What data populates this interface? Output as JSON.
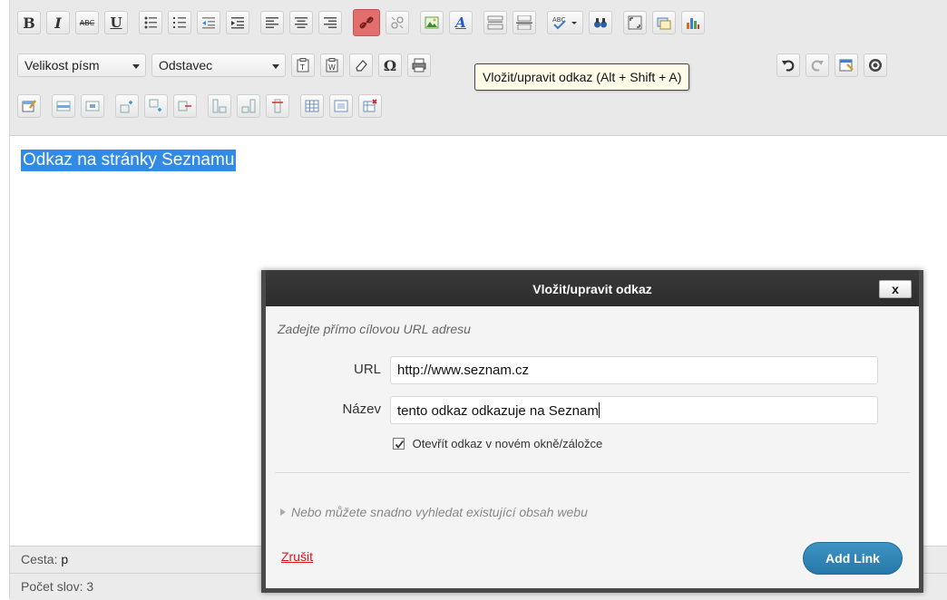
{
  "toolbar": {
    "font_size_label": "Velikost písm",
    "format_label": "Odstavec",
    "tooltip": "Vložit/upravit odkaz (Alt + Shift + A)"
  },
  "content": {
    "selected_text": "Odkaz na stránky Seznamu"
  },
  "status": {
    "path_label": "Cesta:",
    "path_value": "p",
    "word_count": "Počet slov: 3"
  },
  "dialog": {
    "title": "Vložit/upravit odkaz",
    "close_label": "x",
    "hint": "Zadejte přímo cílovou URL adresu",
    "url_label": "URL",
    "url_value": "http://www.seznam.cz",
    "name_label": "Název",
    "name_value": "tento odkaz odkazuje na Seznam",
    "new_window_label": "Otevřít odkaz v novém okně/záložce",
    "new_window_checked": true,
    "search_toggle": "Nebo můžete snadno vyhledat existující obsah webu",
    "cancel_label": "Zrušit",
    "submit_label": "Add Link"
  },
  "colors": {
    "accent_button": "#2678a8",
    "active_tool": "#e36e6e",
    "selection": "#2f8be6",
    "cancel_link": "#d9161c"
  },
  "icons": [
    "bold",
    "italic",
    "strikethrough",
    "underline",
    "bullet-list",
    "numbered-list",
    "outdent",
    "indent",
    "align-left",
    "align-center",
    "align-right",
    "link",
    "unlink",
    "image",
    "text-color",
    "more-tag",
    "page-break",
    "spellcheck",
    "find-replace",
    "fullscreen",
    "media",
    "chart",
    "paste-text",
    "paste-word",
    "eraser",
    "omega",
    "print",
    "undo",
    "redo",
    "properties",
    "help",
    "table",
    "row",
    "column"
  ]
}
